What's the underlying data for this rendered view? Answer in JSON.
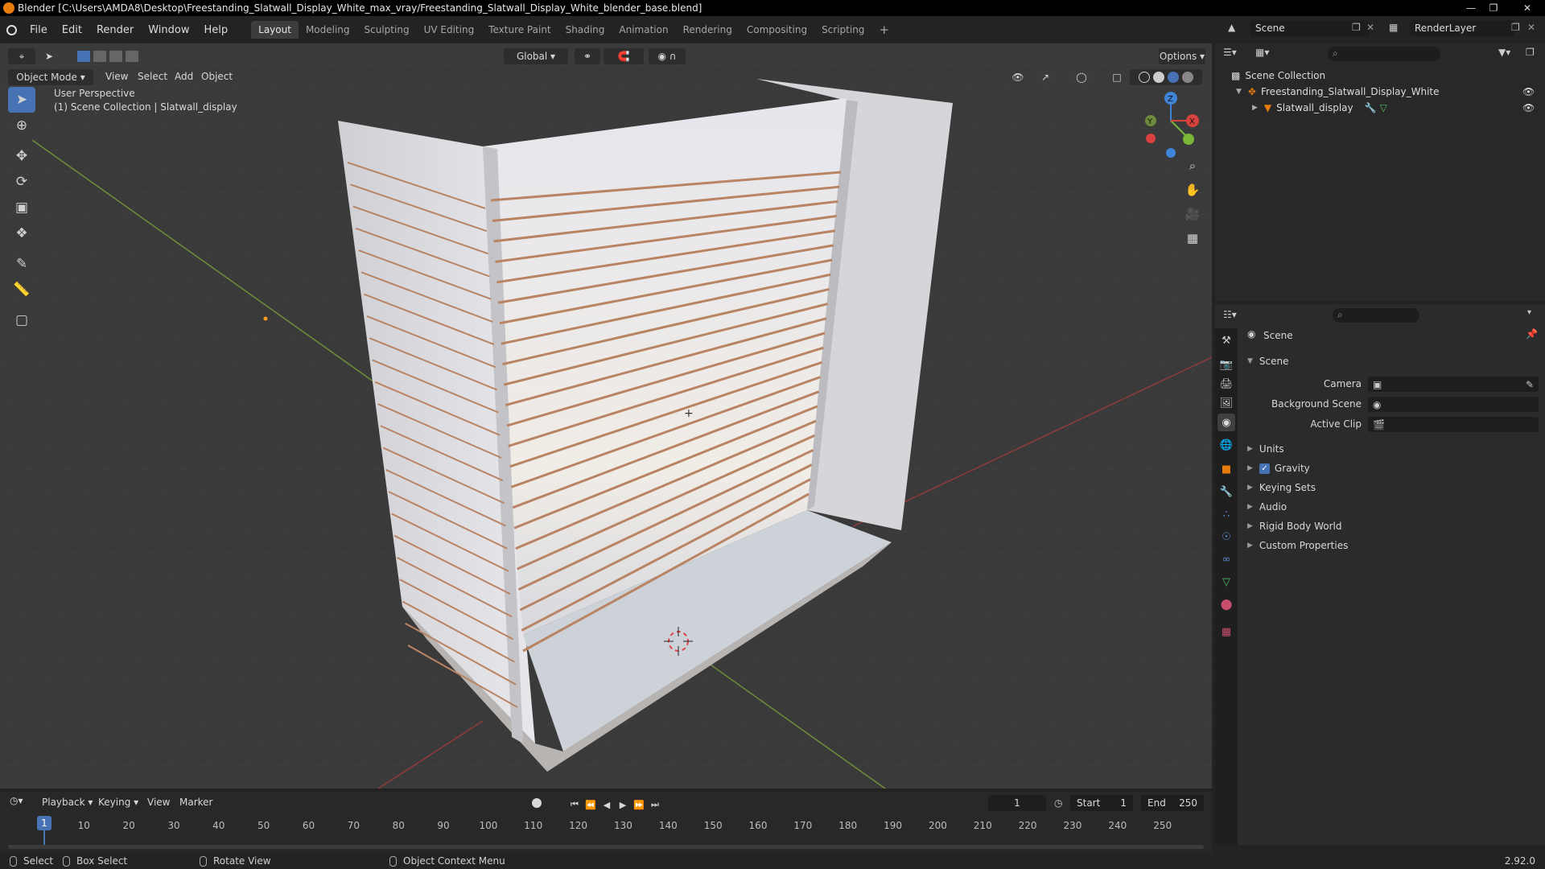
{
  "window": {
    "title": "Blender [C:\\Users\\AMDA8\\Desktop\\Freestanding_Slatwall_Display_White_max_vray/Freestanding_Slatwall_Display_White_blender_base.blend]"
  },
  "menu": {
    "items": [
      "File",
      "Edit",
      "Render",
      "Window",
      "Help"
    ],
    "workspaces": [
      "Layout",
      "Modeling",
      "Sculpting",
      "UV Editing",
      "Texture Paint",
      "Shading",
      "Animation",
      "Rendering",
      "Compositing",
      "Scripting"
    ],
    "active_workspace": "Layout",
    "add_workspace": "+"
  },
  "scene_selector": {
    "scene": "Scene",
    "render_layer": "RenderLayer"
  },
  "viewport": {
    "mode": "Object Mode",
    "menus": [
      "View",
      "Select",
      "Add",
      "Object"
    ],
    "transform_orientation": "Global",
    "options_label": "Options",
    "perspective_label": "User Perspective",
    "collection_label": "(1) Scene Collection | Slatwall_display",
    "gizmo_axes": {
      "x": "X",
      "y": "Y",
      "z": "Z"
    }
  },
  "outliner": {
    "root": "Scene Collection",
    "items": [
      {
        "label": "Freestanding_Slatwall_Display_White"
      },
      {
        "label": "Slatwall_display"
      }
    ]
  },
  "properties": {
    "header": "Scene",
    "section": "Scene",
    "fields": [
      {
        "label": "Camera",
        "value": ""
      },
      {
        "label": "Background Scene",
        "value": ""
      },
      {
        "label": "Active Clip",
        "value": ""
      }
    ],
    "panels": [
      "Units",
      "Gravity",
      "Keying Sets",
      "Audio",
      "Rigid Body World",
      "Custom Properties"
    ],
    "gravity_enabled": true,
    "search_placeholder": ""
  },
  "timeline": {
    "menus": [
      "Playback",
      "Keying",
      "View",
      "Marker"
    ],
    "current_frame": "1",
    "start_label": "Start",
    "start_value": "1",
    "end_label": "End",
    "end_value": "250",
    "playhead_frame": "1",
    "ruler": [
      "10",
      "20",
      "30",
      "40",
      "50",
      "60",
      "70",
      "80",
      "90",
      "100",
      "110",
      "120",
      "130",
      "140",
      "150",
      "160",
      "170",
      "180",
      "190",
      "200",
      "210",
      "220",
      "230",
      "240",
      "250"
    ]
  },
  "statusbar": {
    "select": "Select",
    "box_select": "Box Select",
    "rotate_view": "Rotate View",
    "context_menu": "Object Context Menu",
    "version": "2.92.0"
  },
  "colors": {
    "accent": "#4772b3",
    "axis_x": "#d9413f",
    "axis_y": "#7ab83a",
    "axis_z": "#3f84d6",
    "blender_orange": "#e87d0d"
  }
}
